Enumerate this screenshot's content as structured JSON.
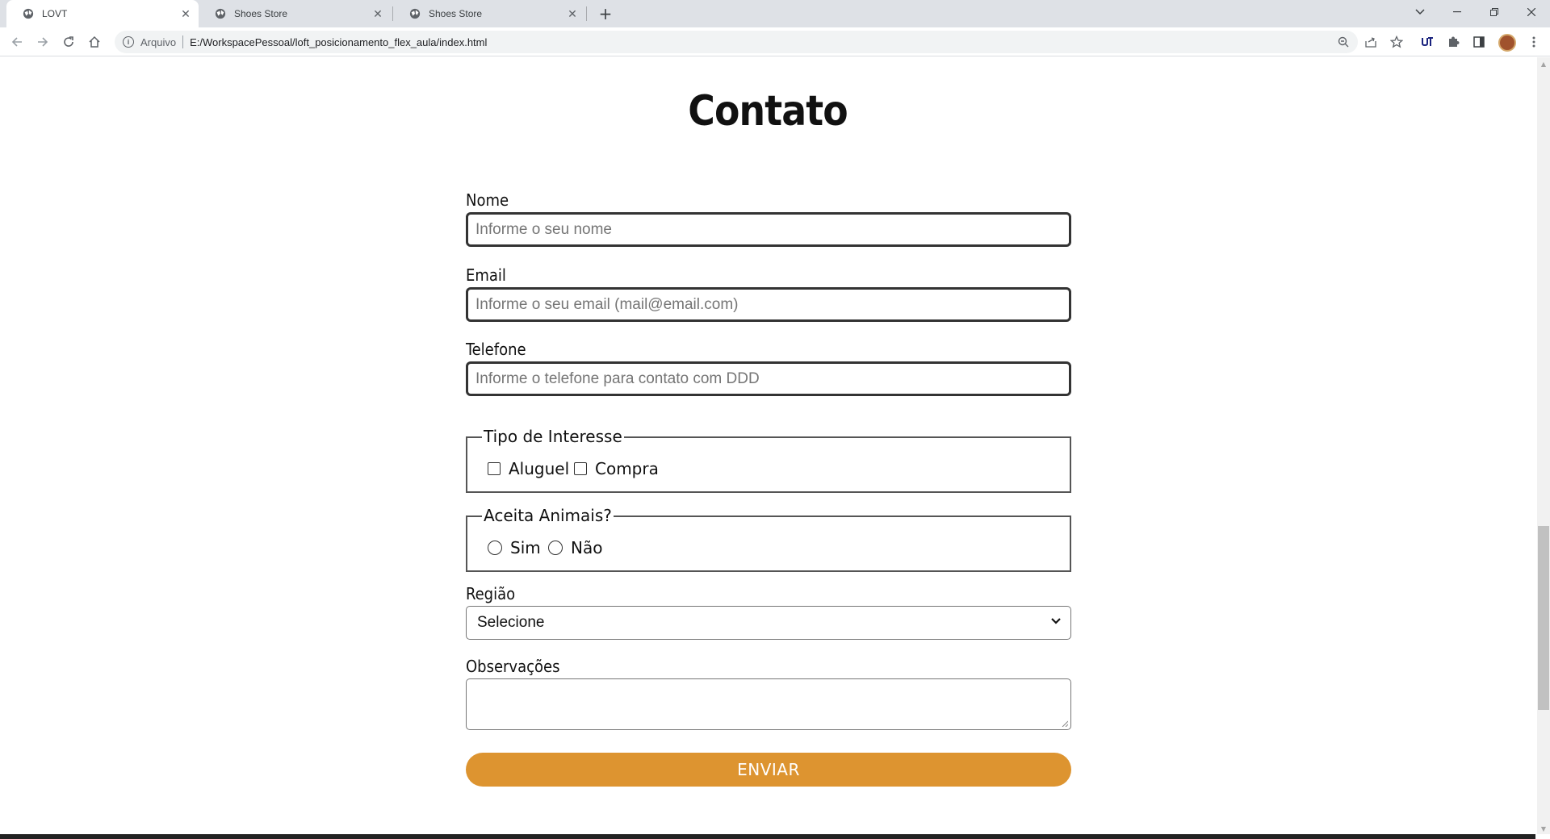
{
  "browser": {
    "tabs": [
      {
        "title": "LOVT",
        "active": true
      },
      {
        "title": "Shoes Store",
        "active": false
      },
      {
        "title": "Shoes Store",
        "active": false
      }
    ],
    "address": {
      "scheme_label": "Arquivo",
      "url": "E:/WorkspacePessoal/loft_posicionamento_flex_aula/index.html"
    }
  },
  "page": {
    "title": "Contato",
    "form": {
      "nome": {
        "label": "Nome",
        "placeholder": "Informe o seu nome"
      },
      "email": {
        "label": "Email",
        "placeholder": "Informe o seu email (mail@email.com)"
      },
      "telefone": {
        "label": "Telefone",
        "placeholder": "Informe o telefone para contato com DDD"
      },
      "interesse": {
        "legend": "Tipo de Interesse",
        "options": [
          "Aluguel",
          "Compra"
        ]
      },
      "animais": {
        "legend": "Aceita Animais?",
        "options": [
          "Sim",
          "Não"
        ]
      },
      "regiao": {
        "label": "Região",
        "selected": "Selecione"
      },
      "observacoes": {
        "label": "Observações",
        "value": ""
      },
      "submit_label": "ENVIAR"
    }
  },
  "colors": {
    "accent": "#dd9430",
    "tab_bar": "#dee1e6"
  }
}
